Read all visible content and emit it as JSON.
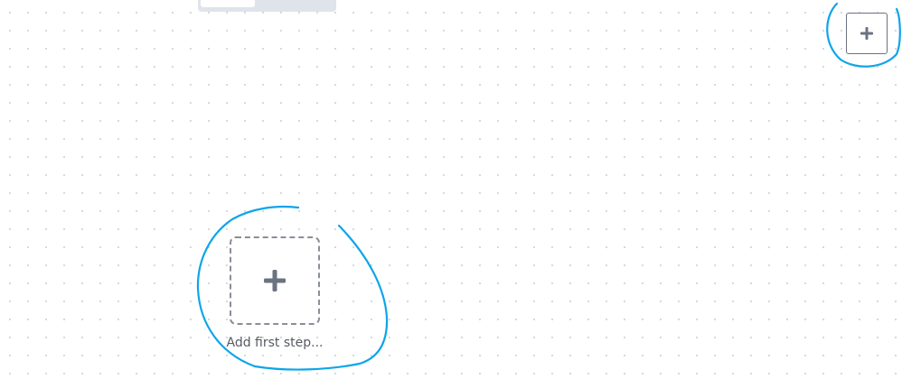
{
  "toolbar": {
    "add_node_icon": "plus-icon"
  },
  "canvas": {
    "first_step": {
      "icon": "plus-icon",
      "label": "Add first step..."
    }
  },
  "colors": {
    "annotation": "#0ea5e9",
    "border": "#8a8f98",
    "icon": "#6b7280",
    "dot_grid": "#d3d6dc"
  }
}
